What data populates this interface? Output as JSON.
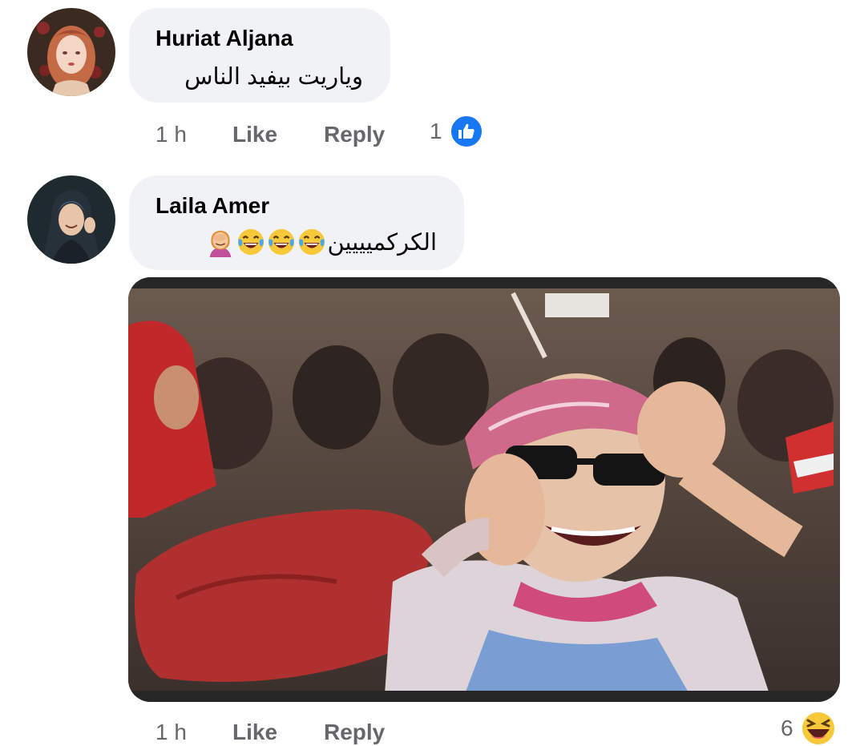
{
  "comments": [
    {
      "author": "Huriat Aljana",
      "text": "وياريت بيفيد الناس",
      "time": "1 h",
      "like_label": "Like",
      "reply_label": "Reply",
      "reaction_count": "1",
      "reaction_icon": "like-icon"
    },
    {
      "author": "Laila Amer",
      "text": "الكركميييين",
      "emojis": [
        "face-with-tears-of-joy-icon",
        "face-with-tears-of-joy-icon",
        "face-with-tears-of-joy-icon",
        "woman-facepalming-icon"
      ],
      "time": "1 h",
      "like_label": "Like",
      "reply_label": "Reply",
      "reaction_count": "6",
      "reaction_icon": "haha-icon"
    }
  ],
  "colors": {
    "bubble": "#f0f2f5",
    "meta_text": "#65676b",
    "like_blue": "#1877f2",
    "haha_yellow": "#f7c93a"
  }
}
